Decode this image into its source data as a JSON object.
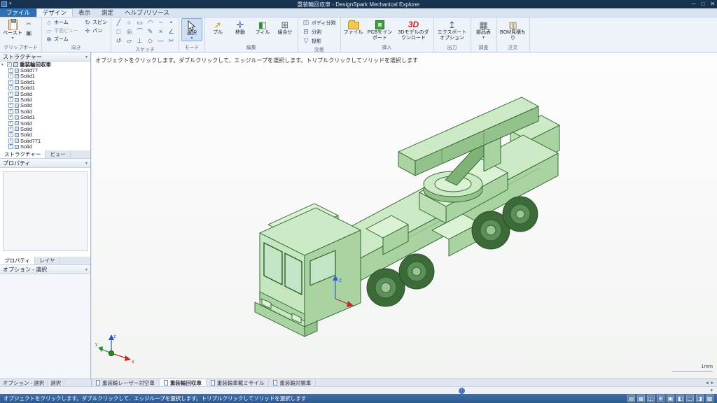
{
  "colors": {
    "titlebar": "#16324e",
    "accent_blue": "#2f6fb4",
    "model_green": "#c9e7c2",
    "status_blue": "#33639c"
  },
  "titlebar": {
    "title": "重装輪回収車 - DesignSpark Mechanical Explorer",
    "controls": {
      "minimize": "─",
      "maximize": "□",
      "close": "✕"
    }
  },
  "menubar": {
    "file": "ファイル",
    "tabs": [
      "デザイン",
      "表示",
      "測定",
      "ヘルプ /リソース"
    ],
    "active_tab": "デザイン"
  },
  "ribbon": {
    "clipboard": {
      "label": "クリップボード",
      "paste": "ペースト",
      "caret": "▾",
      "mini": [
        "✂",
        "▣"
      ]
    },
    "orient": {
      "label": "向き",
      "buttons": [
        {
          "label": "ホーム",
          "icon": "⌂"
        },
        {
          "label": "スピン",
          "icon": "↻"
        },
        {
          "label": "平面ビュー",
          "icon": "▱",
          "disabled": true
        },
        {
          "label": "パン",
          "icon": "✛"
        },
        {
          "label": "ズーム",
          "icon": "⊕"
        }
      ]
    },
    "sketch": {
      "label": "スケッチ",
      "icons": [
        "╱",
        "○",
        "▭",
        "◠",
        "~",
        "•",
        "□",
        "◎",
        "⌒",
        "✎",
        "×",
        "∠",
        "↺",
        "▱",
        "⊥",
        "◇",
        "―",
        "✂"
      ]
    },
    "mode": {
      "label": "モード",
      "select": "選択",
      "caret": "▾"
    },
    "edit": {
      "label": "編集",
      "buttons": [
        {
          "label": "プル",
          "icon": "➚"
        },
        {
          "label": "移動",
          "icon": "✛"
        },
        {
          "label": "フィル",
          "icon": "◧"
        },
        {
          "label": "組合せ",
          "icon": "⊞"
        }
      ]
    },
    "intersect": {
      "label": "交差",
      "buttons": [
        {
          "label": "ボディ分割",
          "icon": "◫"
        },
        {
          "label": "分割",
          "icon": "⊟"
        },
        {
          "label": "投影",
          "icon": "▽"
        }
      ]
    },
    "insert": {
      "label": "挿入",
      "buttons": [
        "ファイル",
        "PCBをインポート",
        "3Dモデルのダウンロード"
      ],
      "logo3d": "3D"
    },
    "output": {
      "label": "出力",
      "buttons": [
        "エクスポートオプション"
      ],
      "icon": "↥"
    },
    "inspect": {
      "label": "調査",
      "buttons": [
        "部品表"
      ],
      "icon": "▦",
      "caret": "▾"
    },
    "order": {
      "label": "注文",
      "buttons": [
        "BOM見積もり"
      ],
      "icon": "▥"
    }
  },
  "structure": {
    "header": "ストラクチャー",
    "root": "重装輪回収車",
    "items": [
      "Solid77",
      "Solid1",
      "Solid1",
      "Solid1",
      "Solid",
      "Solid",
      "Solid",
      "Solid",
      "Solid1",
      "Solid",
      "Solid",
      "Solid",
      "Solid771",
      "Solid"
    ],
    "tabs": [
      "ストラクチャー",
      "ビュー"
    ]
  },
  "properties": {
    "header": "プロパティ",
    "tabs": [
      "プロパティ",
      "レイヤ"
    ]
  },
  "options": {
    "header": "オプション - 選択"
  },
  "bottom_tabs": [
    "オプション - 選択",
    "選択"
  ],
  "viewport": {
    "hint": "オブジェクトをクリックします。ダブルクリックして、エッジループを選択します。トリプルクリックしてソリッドを選択します",
    "scale": "1mm",
    "axis_labels": {
      "x": "x",
      "y": "y",
      "z": "z"
    }
  },
  "doc_tabs": [
    {
      "label": "重装輪レーザー対空車",
      "active": false
    },
    {
      "label": "重装輪回収車",
      "active": true
    },
    {
      "label": "重装輪車載ミサイル",
      "active": false
    },
    {
      "label": "重装輪対艦車",
      "active": false
    }
  ],
  "doc_nav": {
    "prev": "◂",
    "next": "▸"
  },
  "notify": {
    "icon": "ⓘ",
    "caret": "▾"
  },
  "statusbar": {
    "text": "オブジェクトをクリックします。ダブルクリックして、エッジループを選択します。トリプルクリックしてソリッドを選択します",
    "icons": [
      "▤",
      "▦",
      "◫",
      "⊞",
      "▣",
      "◧",
      "▢",
      "◨",
      "▩"
    ]
  }
}
